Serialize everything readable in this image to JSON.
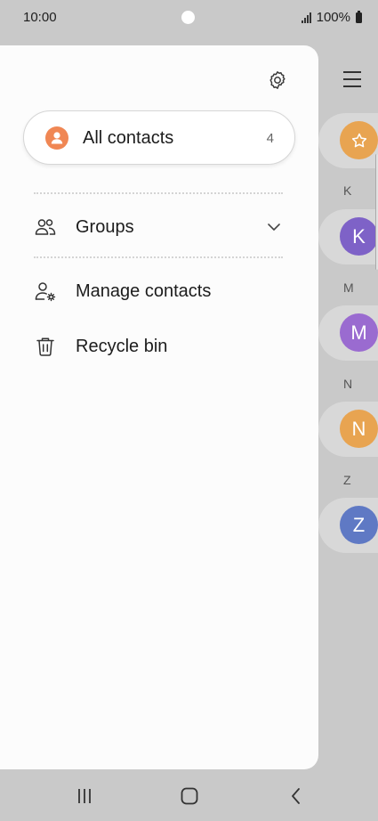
{
  "status_bar": {
    "time": "10:00",
    "battery": "100%"
  },
  "drawer": {
    "all_contacts": {
      "label": "All contacts",
      "count": "4"
    },
    "items": [
      {
        "label": "Groups",
        "icon": "groups-icon"
      },
      {
        "label": "Manage contacts",
        "icon": "manage-contacts-icon"
      },
      {
        "label": "Recycle bin",
        "icon": "trash-icon"
      }
    ]
  },
  "background_list": {
    "index_letters": [
      "K",
      "M",
      "N",
      "Z"
    ],
    "avatars": [
      "K",
      "M",
      "N",
      "Z"
    ],
    "colors": {
      "favorite": "#e8a451",
      "K": "#7e62c7",
      "M": "#9a6bd0",
      "N": "#e8a451",
      "Z": "#5f79c4"
    }
  },
  "nav_bar": {
    "icons": [
      "recent-apps-icon",
      "home-icon",
      "back-icon"
    ]
  }
}
